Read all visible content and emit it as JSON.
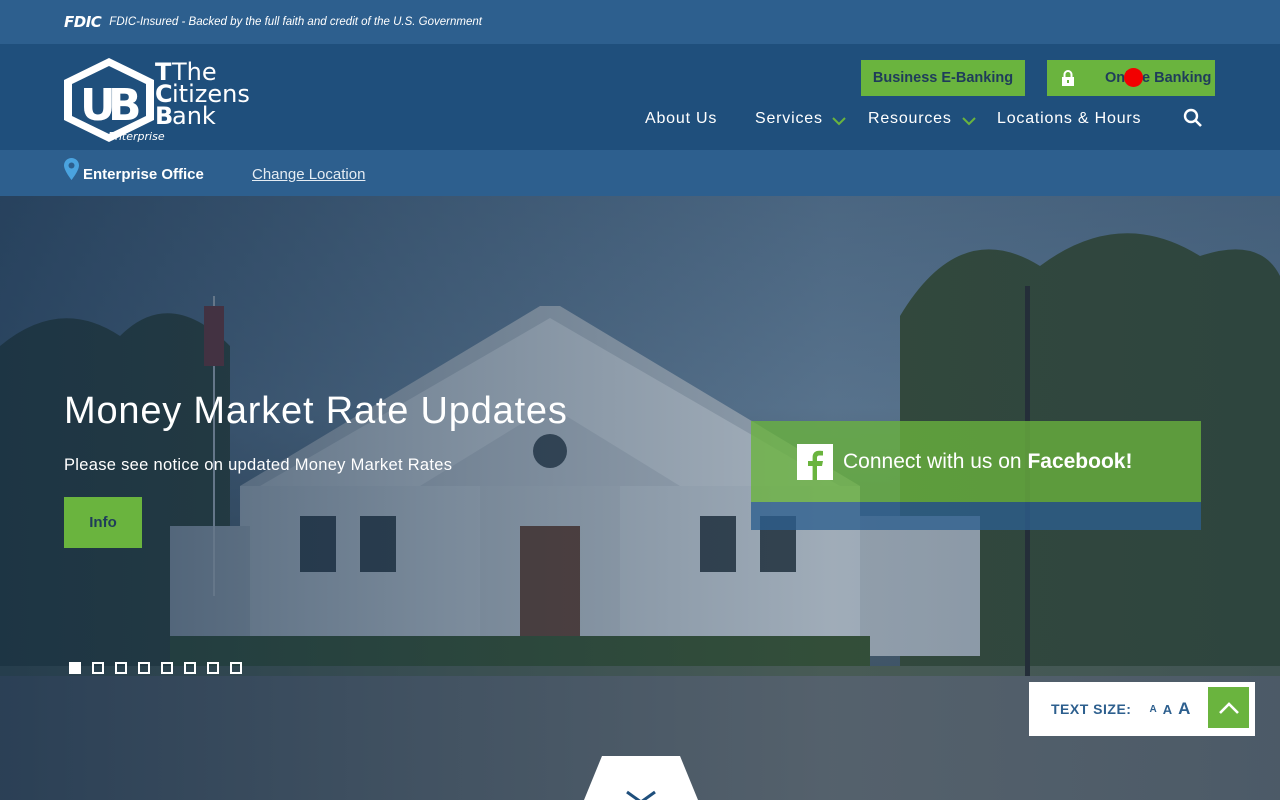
{
  "fdic": {
    "logo": "FDIC",
    "notice": "FDIC-Insured - Backed by the full faith and credit of the U.S. Government"
  },
  "header": {
    "logo": {
      "line1": "The",
      "line2": "Citizens",
      "line3": "Bank",
      "tagline": "Enterprise"
    },
    "business_banking_label": "Business E-Banking",
    "online_banking_label": "Online Banking",
    "nav": [
      {
        "label": "About Us",
        "has_dropdown": false
      },
      {
        "label": "Services",
        "has_dropdown": true
      },
      {
        "label": "Resources",
        "has_dropdown": true
      },
      {
        "label": "Locations & Hours",
        "has_dropdown": false
      }
    ],
    "search_icon": "search-icon"
  },
  "location": {
    "name": "Enterprise Office",
    "change_label": "Change Location"
  },
  "hero": {
    "title": "Money Market Rate Updates",
    "subtitle": "Please see notice on updated Money Market Rates",
    "button_label": "Info",
    "facebook": {
      "prefix": "Connect with us on ",
      "emphasis": "Facebook!"
    },
    "slide_count": 8,
    "active_slide": 1
  },
  "text_size": {
    "label": "TEXT SIZE:",
    "small": "A",
    "medium": "A",
    "large": "A"
  },
  "colors": {
    "brand_blue": "#1f4f7c",
    "bar_blue": "#2d5f8e",
    "accent_green": "#6ab43e",
    "click_marker": "#f20000"
  }
}
